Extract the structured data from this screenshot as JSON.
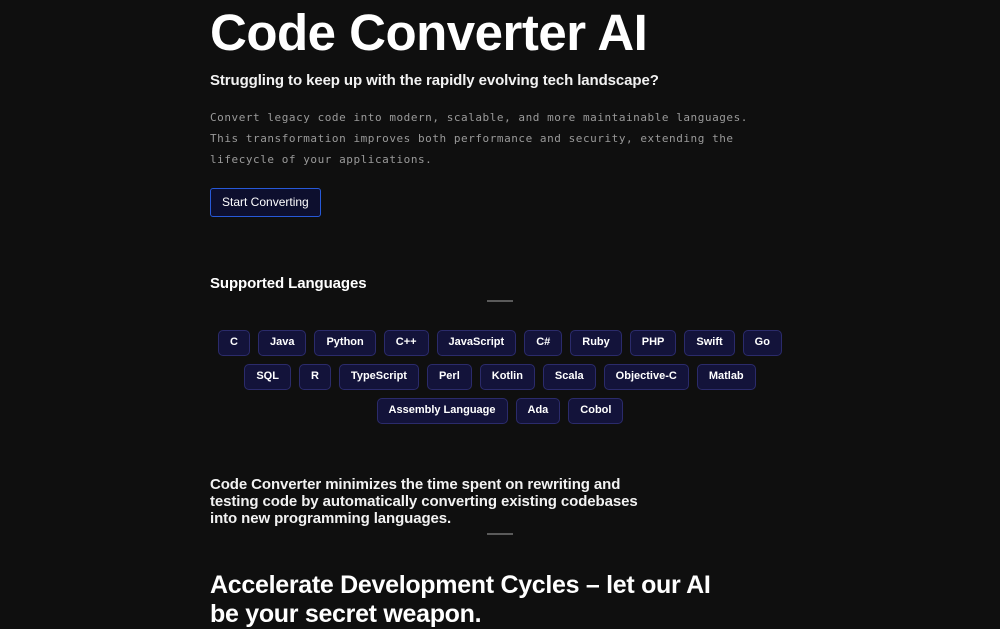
{
  "theme": {
    "background": "#0f0f0f",
    "text_primary": "#ffffff",
    "text_muted": "#9a9a9a",
    "accent_blue": "#2759d8",
    "chip_bg": "#13133a",
    "chip_border": "#2b2b6b",
    "rule": "#5a5a5a"
  },
  "hero": {
    "title": "Code Converter AI",
    "subtitle": "Struggling to keep up with the rapidly evolving tech landscape?",
    "body": "Convert legacy code into modern, scalable, and more maintainable languages. This transformation improves both performance and security, extending the lifecycle of your applications.",
    "cta_label": "Start Converting"
  },
  "languages": {
    "heading": "Supported Languages",
    "items": [
      "C",
      "Java",
      "Python",
      "C++",
      "JavaScript",
      "C#",
      "Ruby",
      "PHP",
      "Swift",
      "Go",
      "SQL",
      "R",
      "TypeScript",
      "Perl",
      "Kotlin",
      "Scala",
      "Objective-C",
      "Matlab",
      "Assembly Language",
      "Ada",
      "Cobol"
    ]
  },
  "feature": {
    "blurb": "Code Converter minimizes the time spent on rewriting and testing code by automatically converting existing codebases into new programming languages.",
    "headline": "Accelerate Development Cycles – let our AI be your secret weapon."
  }
}
